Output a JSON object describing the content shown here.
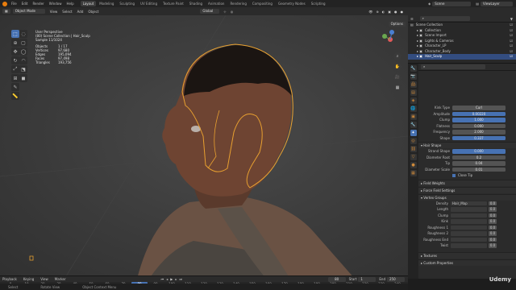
{
  "app": {
    "menu": [
      "File",
      "Edit",
      "Render",
      "Window",
      "Help"
    ],
    "workspace_tabs": [
      "Layout",
      "Modeling",
      "Sculpting",
      "UV Editing",
      "Texture Paint",
      "Shading",
      "Animation",
      "Rendering",
      "Compositing",
      "Geometry Nodes",
      "Scripting"
    ],
    "active_tab": "Layout",
    "scene": "Scene",
    "view_layer": "ViewLayer"
  },
  "viewport": {
    "mode": "Object Mode",
    "menus": [
      "View",
      "Select",
      "Add",
      "Object"
    ],
    "orientation": "Global",
    "options": "Options",
    "overlay_title": "User Perspective",
    "overlay_collection": "(80) Scene Collection | Hair_Sculp",
    "overlay_sample": "Sample 11/1024",
    "stats": [
      {
        "k": "Objects",
        "v": "1 / 17"
      },
      {
        "k": "Vertices",
        "v": "97,680"
      },
      {
        "k": "Edges",
        "v": "195,094"
      },
      {
        "k": "Faces",
        "v": "97,498"
      },
      {
        "k": "Triangles",
        "v": "193,756"
      }
    ]
  },
  "outliner": {
    "rows": [
      {
        "label": "Scene Collection",
        "indent": 0,
        "sel": false
      },
      {
        "label": "Collection",
        "indent": 1,
        "sel": false
      },
      {
        "label": "Scene Import",
        "indent": 1,
        "sel": false
      },
      {
        "label": "Lights & Cameras",
        "indent": 1,
        "sel": false
      },
      {
        "label": "Character_LP",
        "indent": 1,
        "sel": false
      },
      {
        "label": "Character_Body",
        "indent": 1,
        "sel": false
      },
      {
        "label": "Hair_Sculp",
        "indent": 1,
        "sel": true
      }
    ]
  },
  "properties": {
    "kink": [
      {
        "label": "Kink Type",
        "value": "Curl",
        "blue": false
      },
      {
        "label": "Amplitude",
        "value": "0.00220",
        "blue": true
      },
      {
        "label": "Clump",
        "value": "1.000",
        "blue": true
      },
      {
        "label": "Flatness",
        "value": "0.000",
        "blue": false
      },
      {
        "label": "Frequency",
        "value": "2.000",
        "blue": false
      },
      {
        "label": "Shape",
        "value": "0.337",
        "blue": true
      }
    ],
    "hair_shape_title": "Hair Shape",
    "hair_shape": [
      {
        "label": "Strand Shape",
        "value": "0.000",
        "blue": true
      },
      {
        "label": "Diameter Root",
        "value": "0.2",
        "blue": false
      },
      {
        "label": "Tip",
        "value": "0.04",
        "blue": false
      },
      {
        "label": "Diameter Scale",
        "value": "0.01",
        "blue": false
      }
    ],
    "close_tip": "Close Tip",
    "sections": [
      "Field Weights",
      "Force Field Settings"
    ],
    "vertex_groups_title": "Vertex Groups",
    "vertex_groups": [
      {
        "label": "Density",
        "value": "Hair_Map",
        "s": "0.0"
      },
      {
        "label": "Length",
        "value": "",
        "s": "0.0"
      },
      {
        "label": "Clump",
        "value": "",
        "s": "0.0"
      },
      {
        "label": "Kink",
        "value": "",
        "s": "0.0"
      },
      {
        "label": "Roughness 1",
        "value": "",
        "s": "0.0"
      },
      {
        "label": "Roughness 2",
        "value": "",
        "s": "0.0"
      },
      {
        "label": "Roughness End",
        "value": "",
        "s": "0.0"
      },
      {
        "label": "Twist",
        "value": "",
        "s": "0.0"
      }
    ],
    "bottom_sections": [
      "Textures",
      "Custom Properties"
    ]
  },
  "timeline": {
    "menus": [
      "Playback",
      "Keying",
      "View",
      "Marker"
    ],
    "current": "80",
    "start_label": "Start",
    "start": "1",
    "end_label": "End",
    "end": "250",
    "ticks": [
      "0",
      "10",
      "20",
      "30",
      "40",
      "50",
      "60",
      "70",
      "80",
      "90",
      "100",
      "110",
      "120",
      "130",
      "140",
      "150",
      "160",
      "170",
      "180",
      "190",
      "200",
      "210",
      "220",
      "230",
      "240"
    ]
  },
  "statusbar": [
    "Select",
    "Rotate View",
    "Object Context Menu"
  ],
  "watermark": "Udemy",
  "colors": {
    "accent": "#4772b3",
    "selection": "#e8a030",
    "blender_orange": "#e87d0d"
  }
}
